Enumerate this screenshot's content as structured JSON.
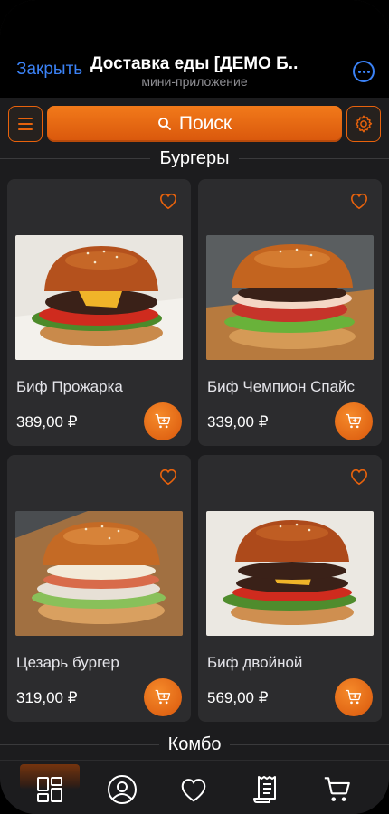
{
  "telegram": {
    "close_label": "Закрыть",
    "title": "Доставка еды [ДЕМО Б...",
    "subtitle": "мини-приложение"
  },
  "toolbar": {
    "search_label": "Поиск"
  },
  "sections": [
    {
      "title": "Бургеры"
    },
    {
      "title": "Комбо"
    }
  ],
  "products": [
    {
      "name": "Биф Прожарка",
      "price": "389,00 ₽"
    },
    {
      "name": "Биф Чемпион Спайс",
      "price": "339,00 ₽"
    },
    {
      "name": "Цезарь бургер",
      "price": "319,00 ₽"
    },
    {
      "name": "Биф двойной",
      "price": "569,00 ₽"
    }
  ],
  "bottom_nav": {
    "items": [
      {
        "icon": "catalog-icon",
        "active": true
      },
      {
        "icon": "profile-icon"
      },
      {
        "icon": "favorites-icon"
      },
      {
        "icon": "orders-icon"
      },
      {
        "icon": "cart-icon"
      }
    ]
  },
  "colors": {
    "accent": "#e8620c",
    "link": "#3b82f6",
    "background": "#1c1c1e",
    "card": "#2c2c2e"
  }
}
